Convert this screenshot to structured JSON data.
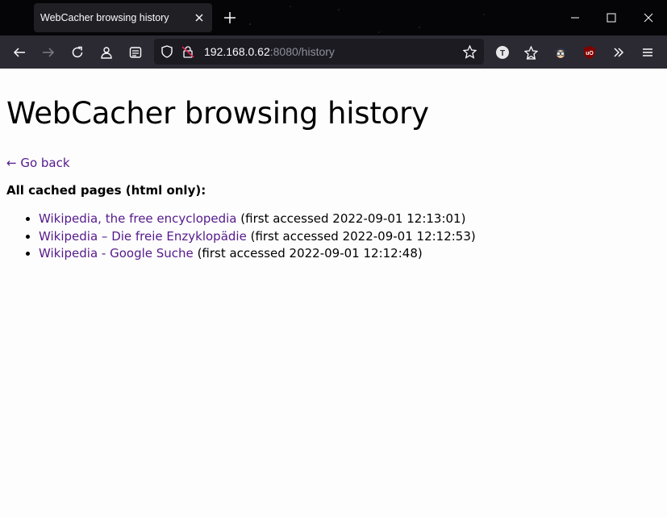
{
  "browser": {
    "tab_title": "WebCacher browsing history",
    "url_host": "192.168.0.62",
    "url_rest": ":8080/history"
  },
  "page": {
    "heading": "WebCacher browsing history",
    "back_link": "← Go back",
    "section_title": "All cached pages (html only):",
    "pages": [
      {
        "title": "Wikipedia, the free encyclopedia",
        "info": "(first accessed 2022-09-01 12:13:01)"
      },
      {
        "title": "Wikipedia – Die freie Enzyklopädie",
        "info": "(first accessed 2022-09-01 12:12:53)"
      },
      {
        "title": "Wikipedia - Google Suche",
        "info": "(first accessed 2022-09-01 12:12:48)"
      }
    ]
  },
  "colors": {
    "link_visited": "#551a8b",
    "titlebar": "#050507",
    "toolbar": "#2b2a33",
    "urlbar": "#1c1b22"
  }
}
